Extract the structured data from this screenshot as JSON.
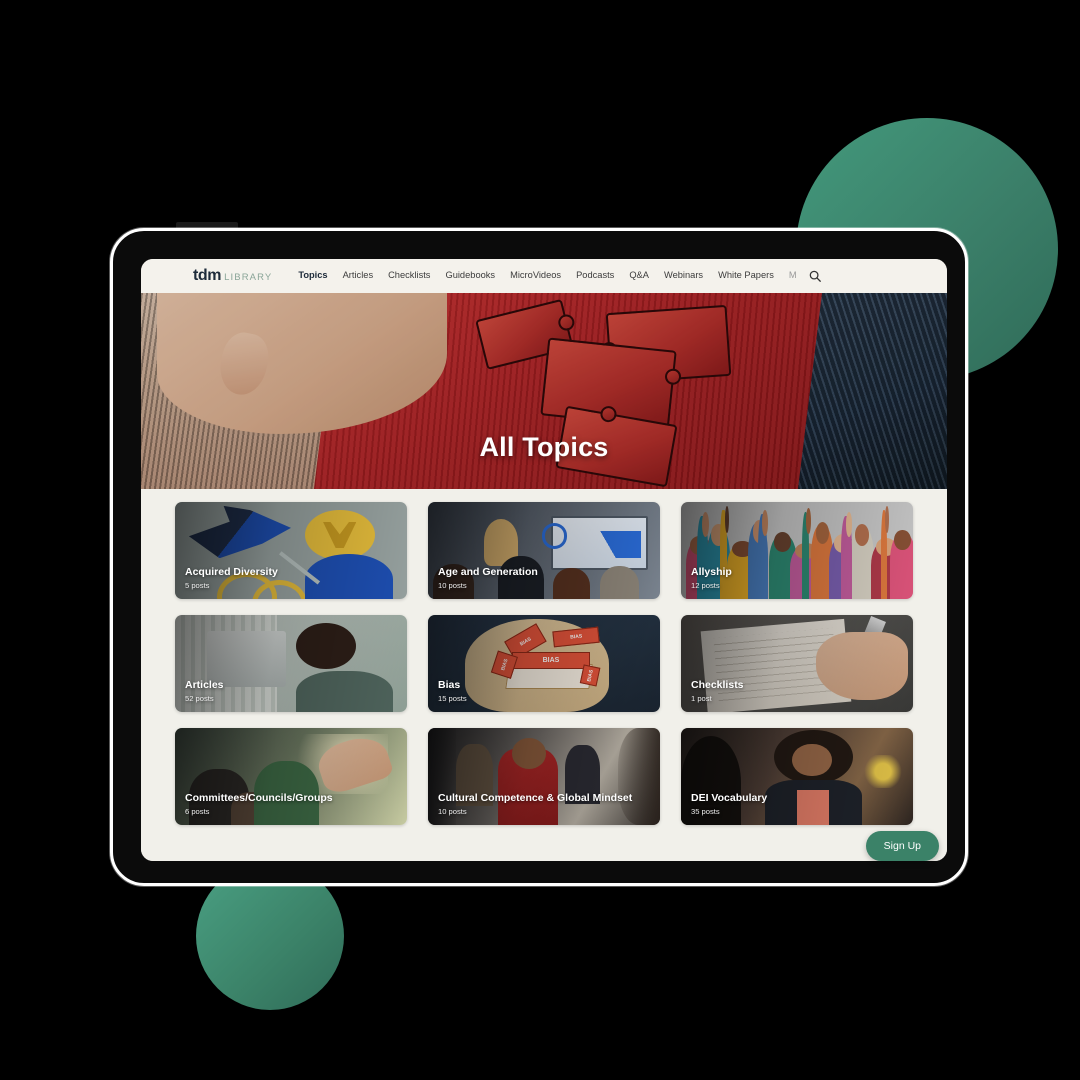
{
  "brand": {
    "name": "tdm",
    "suffix": "LIBRARY"
  },
  "nav": {
    "items": [
      {
        "label": "Topics",
        "active": true
      },
      {
        "label": "Articles",
        "active": false
      },
      {
        "label": "Checklists",
        "active": false
      },
      {
        "label": "Guidebooks",
        "active": false
      },
      {
        "label": "MicroVideos",
        "active": false
      },
      {
        "label": "Podcasts",
        "active": false
      },
      {
        "label": "Q&A",
        "active": false
      },
      {
        "label": "Webinars",
        "active": false
      },
      {
        "label": "White Papers",
        "active": false
      },
      {
        "label": "M",
        "active": false
      }
    ],
    "search_icon": "search-icon"
  },
  "hero": {
    "title": "All Topics"
  },
  "topics": [
    {
      "title": "Acquired Diversity",
      "count": "5 posts",
      "art": "art-acquired"
    },
    {
      "title": "Age and Generation",
      "count": "10 posts",
      "art": "art-meeting"
    },
    {
      "title": "Allyship",
      "count": "12 posts",
      "art": "art-crowd"
    },
    {
      "title": "Articles",
      "count": "52 posts",
      "art": "art-articles"
    },
    {
      "title": "Bias",
      "count": "15 posts",
      "art": "art-bias"
    },
    {
      "title": "Checklists",
      "count": "1 post",
      "art": "art-checklist"
    },
    {
      "title": "Committees/Councils/Groups",
      "count": "6 posts",
      "art": "art-committee"
    },
    {
      "title": "Cultural Competence & Global Mindset",
      "count": "10 posts",
      "art": "art-cultural"
    },
    {
      "title": "DEI Vocabulary",
      "count": "35 posts",
      "art": "art-dei"
    }
  ],
  "bias_art": {
    "labels": [
      "BIAS",
      "BIAS",
      "BIAS",
      "BIAS",
      "BIAS"
    ]
  },
  "signup": {
    "label": "Sign Up"
  },
  "colors": {
    "accent_green": "#3b8268",
    "nav_background": "#f4f2ec",
    "page_background": "#f1f0ea",
    "brand_dark": "#1d2b3a",
    "brand_light_green": "#8aa598",
    "hero_red": "#ab1f22"
  }
}
